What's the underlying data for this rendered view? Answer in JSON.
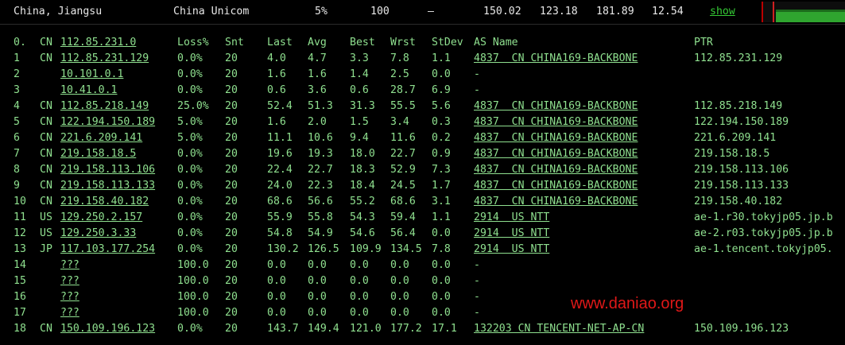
{
  "header": {
    "location": "China, Jiangsu",
    "isp": "China Unicom",
    "loss": "5%",
    "sent": "100",
    "dash": "–",
    "last": "150.02",
    "avg": "123.18",
    "worst": "181.89",
    "stdev": "12.54",
    "show_label": "show"
  },
  "columns": {
    "hop": "0.",
    "cc": "CN",
    "ip": "112.85.231.0",
    "loss": "Loss%",
    "snt": "Snt",
    "last": "Last",
    "avg": "Avg",
    "best": "Best",
    "wrst": "Wrst",
    "stdev": "StDev",
    "as": "AS Name",
    "ptr": "PTR"
  },
  "rows": [
    {
      "hop": "1",
      "cc": "CN",
      "ip": "112.85.231.129",
      "loss": "0.0%",
      "snt": "20",
      "last": "4.0",
      "avg": "4.7",
      "best": "3.3",
      "wrst": "7.8",
      "stdev": "1.1",
      "as": "4837  CN CHINA169-BACKBONE",
      "ptr": "112.85.231.129"
    },
    {
      "hop": "2",
      "cc": "",
      "ip": "10.101.0.1",
      "loss": "0.0%",
      "snt": "20",
      "last": "1.6",
      "avg": "1.6",
      "best": "1.4",
      "wrst": "2.5",
      "stdev": "0.0",
      "as": "-",
      "ptr": ""
    },
    {
      "hop": "3",
      "cc": "",
      "ip": "10.41.0.1",
      "loss": "0.0%",
      "snt": "20",
      "last": "0.6",
      "avg": "3.6",
      "best": "0.6",
      "wrst": "28.7",
      "stdev": "6.9",
      "as": "-",
      "ptr": ""
    },
    {
      "hop": "4",
      "cc": "CN",
      "ip": "112.85.218.149",
      "loss": "25.0%",
      "snt": "20",
      "last": "52.4",
      "avg": "51.3",
      "best": "31.3",
      "wrst": "55.5",
      "stdev": "5.6",
      "as": "4837  CN CHINA169-BACKBONE",
      "ptr": "112.85.218.149"
    },
    {
      "hop": "5",
      "cc": "CN",
      "ip": "122.194.150.189",
      "loss": "5.0%",
      "snt": "20",
      "last": "1.6",
      "avg": "2.0",
      "best": "1.5",
      "wrst": "3.4",
      "stdev": "0.3",
      "as": "4837  CN CHINA169-BACKBONE",
      "ptr": "122.194.150.189"
    },
    {
      "hop": "6",
      "cc": "CN",
      "ip": "221.6.209.141",
      "loss": "5.0%",
      "snt": "20",
      "last": "11.1",
      "avg": "10.6",
      "best": "9.4",
      "wrst": "11.6",
      "stdev": "0.2",
      "as": "4837  CN CHINA169-BACKBONE",
      "ptr": "221.6.209.141"
    },
    {
      "hop": "7",
      "cc": "CN",
      "ip": "219.158.18.5",
      "loss": "0.0%",
      "snt": "20",
      "last": "19.6",
      "avg": "19.3",
      "best": "18.0",
      "wrst": "22.7",
      "stdev": "0.9",
      "as": "4837  CN CHINA169-BACKBONE",
      "ptr": "219.158.18.5"
    },
    {
      "hop": "8",
      "cc": "CN",
      "ip": "219.158.113.106",
      "loss": "0.0%",
      "snt": "20",
      "last": "22.4",
      "avg": "22.7",
      "best": "18.3",
      "wrst": "52.9",
      "stdev": "7.3",
      "as": "4837  CN CHINA169-BACKBONE",
      "ptr": "219.158.113.106"
    },
    {
      "hop": "9",
      "cc": "CN",
      "ip": "219.158.113.133",
      "loss": "0.0%",
      "snt": "20",
      "last": "24.0",
      "avg": "22.3",
      "best": "18.4",
      "wrst": "24.5",
      "stdev": "1.7",
      "as": "4837  CN CHINA169-BACKBONE",
      "ptr": "219.158.113.133"
    },
    {
      "hop": "10",
      "cc": "CN",
      "ip": "219.158.40.182",
      "loss": "0.0%",
      "snt": "20",
      "last": "68.6",
      "avg": "56.6",
      "best": "55.2",
      "wrst": "68.6",
      "stdev": "3.1",
      "as": "4837  CN CHINA169-BACKBONE",
      "ptr": "219.158.40.182"
    },
    {
      "hop": "11",
      "cc": "US",
      "ip": "129.250.2.157",
      "loss": "0.0%",
      "snt": "20",
      "last": "55.9",
      "avg": "55.8",
      "best": "54.3",
      "wrst": "59.4",
      "stdev": "1.1",
      "as": "2914  US NTT",
      "ptr": "ae-1.r30.tokyjp05.jp.b"
    },
    {
      "hop": "12",
      "cc": "US",
      "ip": "129.250.3.33",
      "loss": "0.0%",
      "snt": "20",
      "last": "54.8",
      "avg": "54.9",
      "best": "54.6",
      "wrst": "56.4",
      "stdev": "0.0",
      "as": "2914  US NTT",
      "ptr": "ae-2.r03.tokyjp05.jp.b"
    },
    {
      "hop": "13",
      "cc": "JP",
      "ip": "117.103.177.254",
      "loss": "0.0%",
      "snt": "20",
      "last": "130.2",
      "avg": "126.5",
      "best": "109.9",
      "wrst": "134.5",
      "stdev": "7.8",
      "as": "2914  US NTT",
      "ptr": "ae-1.tencent.tokyjp05."
    },
    {
      "hop": "14",
      "cc": "",
      "ip": "???",
      "loss": "100.0",
      "snt": "20",
      "last": "0.0",
      "avg": "0.0",
      "best": "0.0",
      "wrst": "0.0",
      "stdev": "0.0",
      "as": "-",
      "ptr": ""
    },
    {
      "hop": "15",
      "cc": "",
      "ip": "???",
      "loss": "100.0",
      "snt": "20",
      "last": "0.0",
      "avg": "0.0",
      "best": "0.0",
      "wrst": "0.0",
      "stdev": "0.0",
      "as": "-",
      "ptr": ""
    },
    {
      "hop": "16",
      "cc": "",
      "ip": "???",
      "loss": "100.0",
      "snt": "20",
      "last": "0.0",
      "avg": "0.0",
      "best": "0.0",
      "wrst": "0.0",
      "stdev": "0.0",
      "as": "-",
      "ptr": ""
    },
    {
      "hop": "17",
      "cc": "",
      "ip": "???",
      "loss": "100.0",
      "snt": "20",
      "last": "0.0",
      "avg": "0.0",
      "best": "0.0",
      "wrst": "0.0",
      "stdev": "0.0",
      "as": "-",
      "ptr": ""
    },
    {
      "hop": "18",
      "cc": "CN",
      "ip": "150.109.196.123",
      "loss": "0.0%",
      "snt": "20",
      "last": "143.7",
      "avg": "149.4",
      "best": "121.0",
      "wrst": "177.2",
      "stdev": "17.1",
      "as": "132203 CN TENCENT-NET-AP-CN",
      "ptr": "150.109.196.123"
    }
  ],
  "watermark": "www.daniao.org",
  "colors": {
    "text": "#8fe08f",
    "header_text": "#e8e8e8",
    "show": "#35c935",
    "watermark": "#e01818",
    "background": "#000000"
  }
}
